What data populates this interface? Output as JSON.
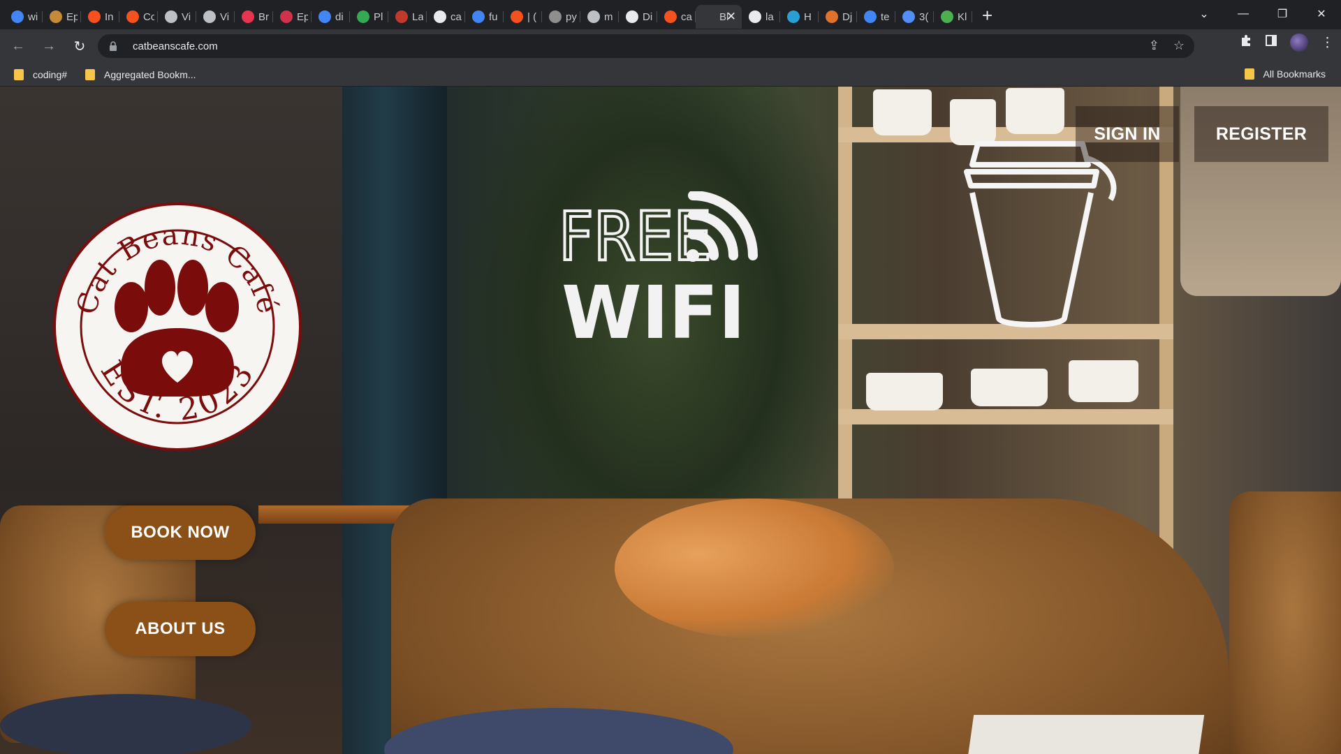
{
  "browser": {
    "tabs": [
      {
        "favicon": "google-icon",
        "title": "wi",
        "color": "#4285f4"
      },
      {
        "favicon": "circle-icon",
        "title": "Ep",
        "color": "#c58a3a"
      },
      {
        "favicon": "ring-icon",
        "title": "In",
        "color": "#f4511e"
      },
      {
        "favicon": "ring-icon",
        "title": "Cc",
        "color": "#f4511e"
      },
      {
        "favicon": "github-icon",
        "title": "Vi",
        "color": "#bdc1c6"
      },
      {
        "favicon": "github-icon",
        "title": "Vi",
        "color": "#bdc1c6"
      },
      {
        "favicon": "record-icon",
        "title": "Br",
        "color": "#e8354f"
      },
      {
        "favicon": "globe-icon",
        "title": "Ep",
        "color": "#d0324b"
      },
      {
        "favicon": "google-icon",
        "title": "di",
        "color": "#4285f4"
      },
      {
        "favicon": "drive-icon",
        "title": "Pl",
        "color": "#34a853"
      },
      {
        "favicon": "circle-icon",
        "title": "La",
        "color": "#c0392b"
      },
      {
        "favicon": "github-icon",
        "title": "ca",
        "color": "#e8eaed"
      },
      {
        "favicon": "google-icon",
        "title": "fu",
        "color": "#4285f4"
      },
      {
        "favicon": "ring-icon",
        "title": "| (",
        "color": "#f4511e"
      },
      {
        "favicon": "circle-icon",
        "title": "py",
        "color": "#8e8e8e"
      },
      {
        "favicon": "target-icon",
        "title": "m",
        "color": "#bdc1c6"
      },
      {
        "favicon": "bookmark-icon",
        "title": "Di",
        "color": "#e8eaed"
      },
      {
        "favicon": "loop-icon",
        "title": "ca",
        "color": "#f4511e"
      },
      {
        "favicon": "blank-icon",
        "title": "Bl",
        "color": "#35363a",
        "active": true
      },
      {
        "favicon": "github-icon",
        "title": "la",
        "color": "#e8eaed"
      },
      {
        "favicon": "wave-icon",
        "title": "H",
        "color": "#2a9fd6"
      },
      {
        "favicon": "flame-icon",
        "title": "Dj",
        "color": "#e0722b"
      },
      {
        "favicon": "google-icon",
        "title": "te",
        "color": "#4285f4"
      },
      {
        "favicon": "cube-icon",
        "title": "3(",
        "color": "#4f8ff7"
      },
      {
        "favicon": "leaf-icon",
        "title": "Kl",
        "color": "#4caf50"
      }
    ],
    "url": "catbeanscafe.com",
    "bookmarks": [
      {
        "label": "coding#"
      },
      {
        "label": "Aggregated Bookm..."
      }
    ],
    "all_bookmarks": "All Bookmarks"
  },
  "page": {
    "logo_text_top": "Cat Beans Café",
    "logo_text_bottom": "EST. 2023",
    "wifi_top": "FREE",
    "wifi_bottom": "WIFI",
    "nav": {
      "sign_in": "SIGN IN",
      "register": "REGISTER"
    },
    "actions": {
      "book_now": "BOOK NOW",
      "about_us": "ABOUT US"
    },
    "colors": {
      "brand_red": "#7a0c0c",
      "button_brown": "#8a5018"
    }
  }
}
